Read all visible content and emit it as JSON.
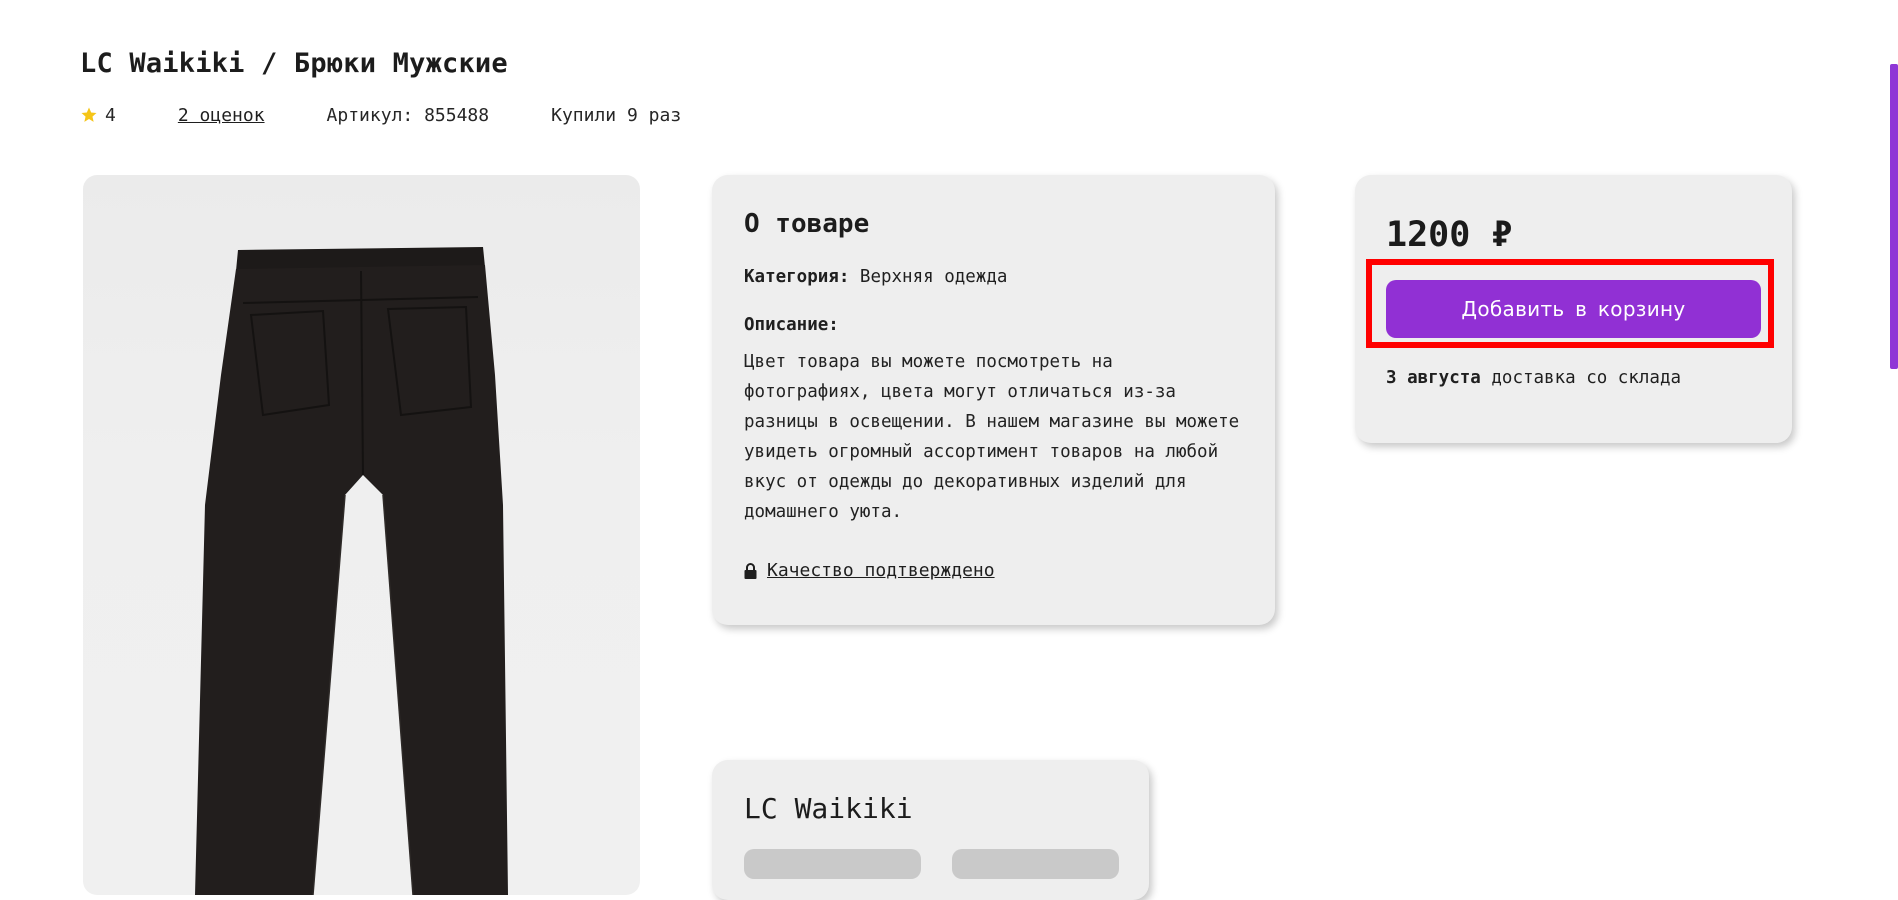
{
  "product": {
    "title": "LC Waikiki / Брюки Мужские",
    "rating": "4",
    "reviews_link": "2 оценок",
    "article": "Артикул: 855488",
    "purchases": "Купили 9 раз"
  },
  "about": {
    "heading": "О товаре",
    "category_label": "Категория:",
    "category_value": "Верхняя одежда",
    "description_label": "Описание:",
    "description": "Цвет товара вы можете посмотреть на фотографиях, цвета могут отличаться из-за разницы в освещении. В нашем магазине вы можете увидеть огромный ассортимент товаров на любой вкус от одежды до декоративных изделий для домашнего уюта.",
    "quality_link": "Качество подтверждено"
  },
  "buy": {
    "price": "1200 ₽",
    "add_to_cart": "Добавить в корзину",
    "delivery_date": "3 августа",
    "delivery_text": "доставка со склада"
  },
  "brand": {
    "name": "LC Waikiki"
  },
  "colors": {
    "accent": "#9130d4",
    "highlight": "#ff0000",
    "star": "#f5c518",
    "card": "#eeeeee"
  },
  "icons": {
    "rating": "star-icon",
    "quality": "lock-icon"
  }
}
